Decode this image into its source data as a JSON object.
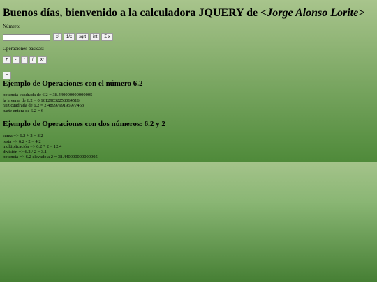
{
  "page": {
    "title_prefix": "Buenos días, bienvenido a la calculadora JQUERY de ",
    "title_author": "<Jorge Alonso Lorite>"
  },
  "number_section": {
    "label": "Número:",
    "input_value": "",
    "buttons": [
      "x²",
      "1/x",
      "sqrt",
      "int",
      "Σ x"
    ]
  },
  "ops_section": {
    "label": "Operaciones básicas:",
    "buttons": [
      "+",
      "-",
      "*",
      "/",
      "xʸ"
    ],
    "equals": "="
  },
  "example_one": {
    "heading": "Ejemplo de Operaciones con el número 6.2",
    "lines": [
      "potencia cuadrada de 6.2 = 38.440000000000005",
      "la inversa de 6.2 = 0.16129032258064516",
      "raiz cuadrada de 6.2 = 2.4899799195977463",
      "parte entera de 6.2 = 6"
    ]
  },
  "example_two": {
    "heading": "Ejemplo de Operaciones con dos números: 6.2 y 2",
    "lines": [
      "suma => 6.2 + 2 = 8.2",
      "resta => 6.2 - 2 = 4.2",
      "multiplicación => 6.2 * 2 = 12.4",
      "división => 6.2 / 2 = 3.1",
      "potencia => 6.2 elevado a 2 = 38.440000000000005"
    ]
  }
}
